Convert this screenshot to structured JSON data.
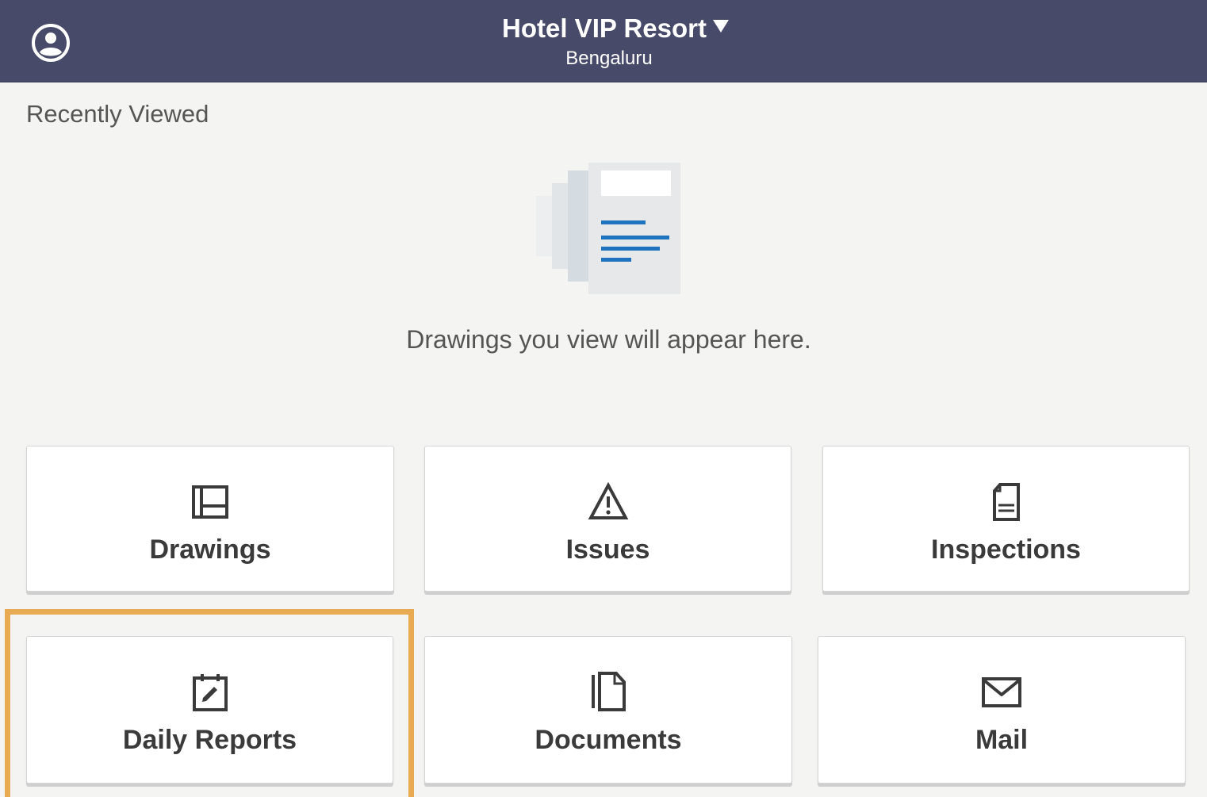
{
  "header": {
    "project_name": "Hotel VIP Resort",
    "project_location": "Bengaluru",
    "background_color": "#474b69",
    "profile_icon": "user-circle-icon",
    "dropdown_icon": "caret-down-icon"
  },
  "recently_viewed": {
    "title": "Recently Viewed",
    "empty_message": "Drawings you view will appear here.",
    "illustration": "drawing-stack-icon"
  },
  "tools": [
    {
      "label": "Drawings",
      "icon": "drawings-icon"
    },
    {
      "label": "Issues",
      "icon": "warning-triangle-icon"
    },
    {
      "label": "Inspections",
      "icon": "inspection-sheet-icon"
    },
    {
      "label": "Daily Reports",
      "icon": "daily-report-icon"
    },
    {
      "label": "Documents",
      "icon": "documents-icon"
    },
    {
      "label": "Mail",
      "icon": "mail-icon"
    }
  ],
  "highlight": {
    "target": "Daily Reports",
    "color": "#e8aa52"
  }
}
